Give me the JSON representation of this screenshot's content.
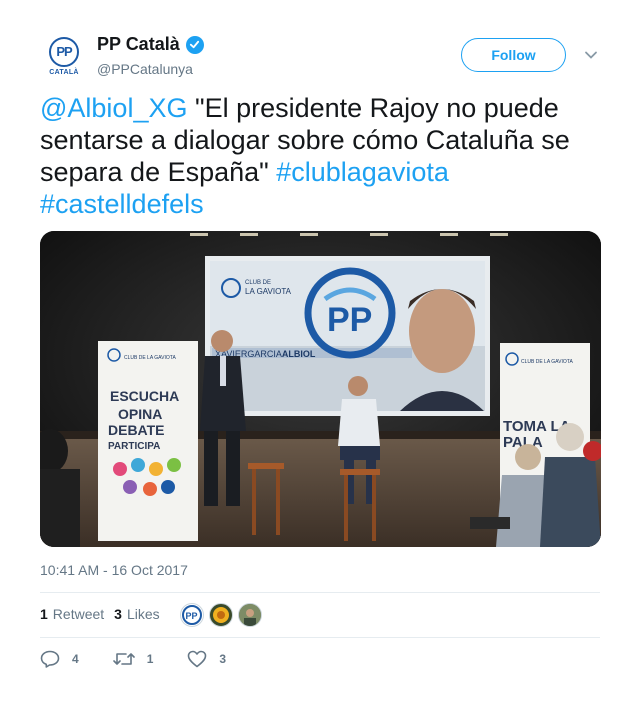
{
  "author": {
    "name": "PP Català",
    "handle": "@PPCatalunya",
    "avatar_text": "PP",
    "avatar_subtext": "CATALÀ",
    "brand_color": "#1d5aa6",
    "verified_color": "#1da1f2"
  },
  "follow_label": "Follow",
  "tweet": {
    "mention": "@Albiol_XG",
    "text": " \"El presidente Rajoy no puede sentarse a dialogar sobre cómo Cataluña se separa de España\" ",
    "hashtag1": "#clublagaviota",
    "hashtag2": "#castelldefels"
  },
  "media": {
    "screen_club_line1": "CLUB DE",
    "screen_club_line2": "LA GAVIOTA",
    "screen_logo": "PP",
    "screen_name_part1": "XAVIER",
    "screen_name_part2": "GARCIA",
    "screen_name_part3": "ALBIOL",
    "banner_left_lines": [
      "ESCUCHA",
      "OPINA",
      "DEBATE",
      "PARTICIPA"
    ],
    "banner_left_club": "CLUB DE LA GAVIOTA",
    "banner_right_club": "CLUB DE LA GAVIOTA",
    "banner_right_lines": [
      "TOMA LA",
      "PALA"
    ]
  },
  "timestamp": "10:41 AM - 16 Oct 2017",
  "stats": {
    "retweets_count": "1",
    "retweets_label": "Retweet",
    "likes_count": "3",
    "likes_label": "Likes"
  },
  "actions": {
    "reply_count": "4",
    "retweet_count": "1",
    "like_count": "3"
  },
  "colors": {
    "link": "#1da1f2",
    "muted": "#657786",
    "divider": "#e6ecf0"
  }
}
